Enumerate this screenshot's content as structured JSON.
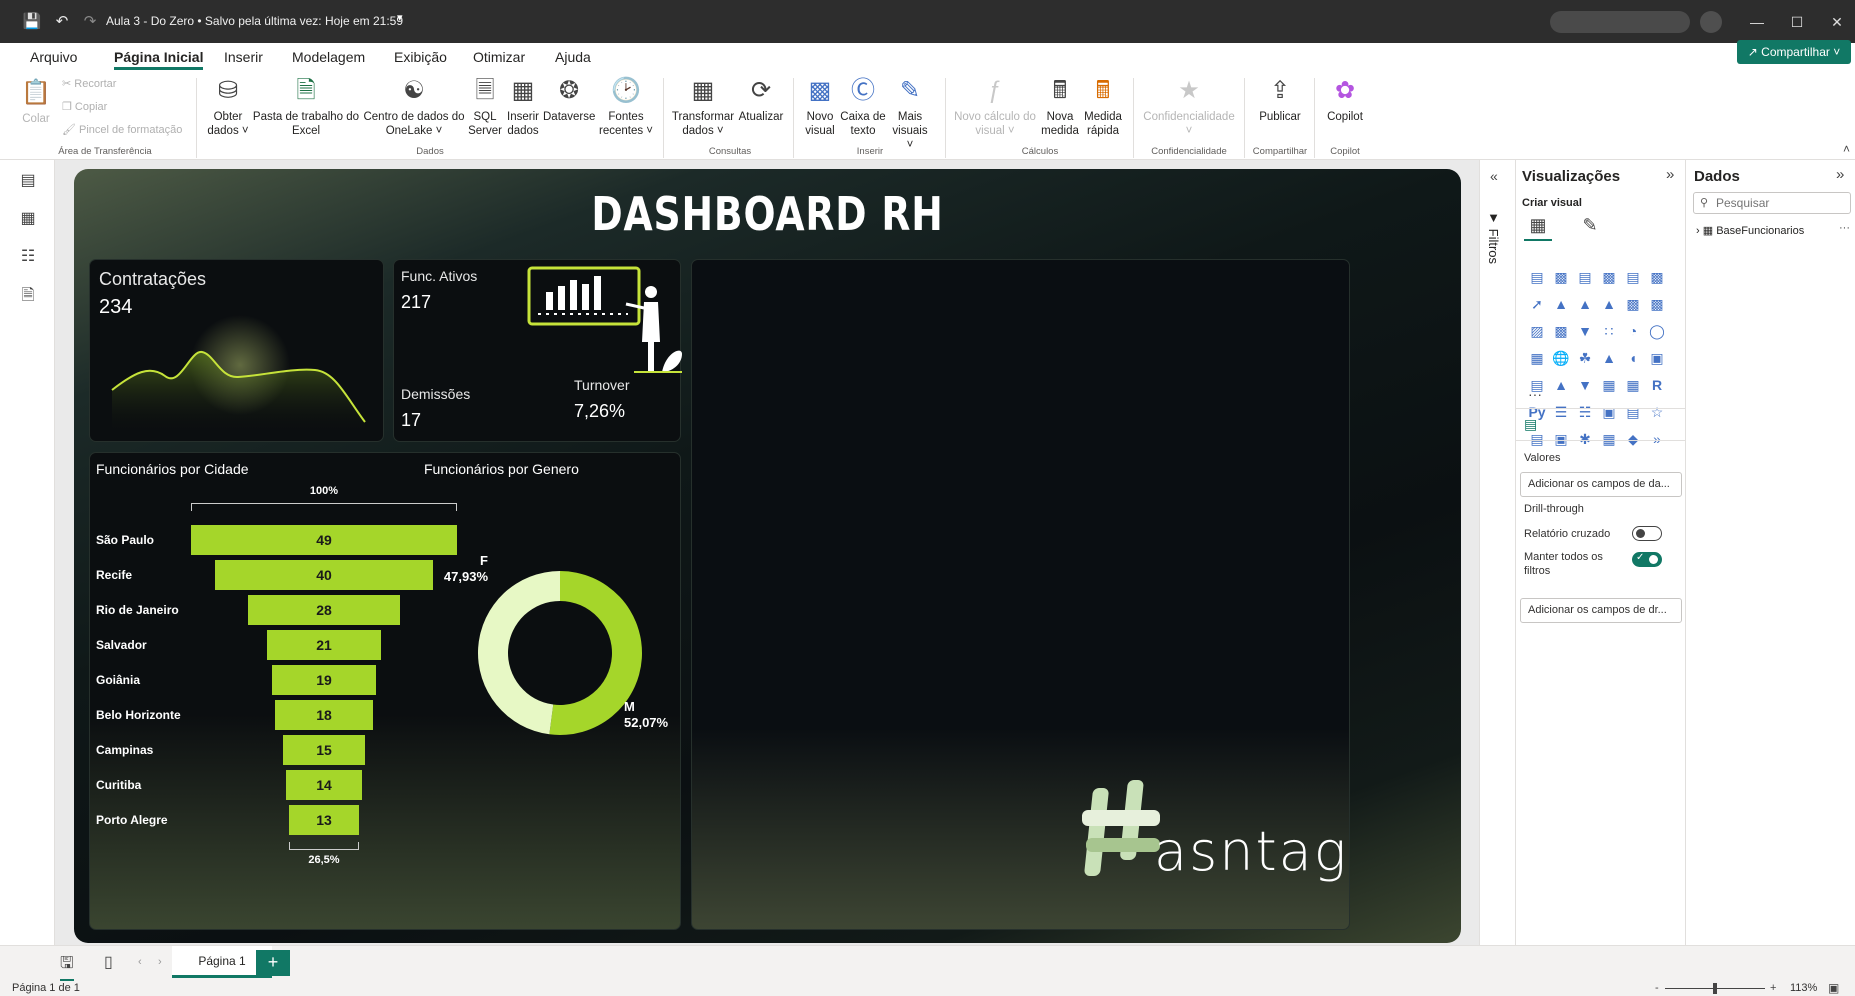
{
  "titlebar": {
    "title": "Aula 3 - Do Zero • Salvo pela última vez: Hoje em 21:59",
    "dropdown_glyph": "▾",
    "icons": [
      "save-icon",
      "undo-icon",
      "redo-icon"
    ],
    "window_controls": [
      "minimize",
      "maximize",
      "close"
    ]
  },
  "menu": {
    "items": [
      "Arquivo",
      "Página Inicial",
      "Inserir",
      "Modelagem",
      "Exibição",
      "Otimizar",
      "Ajuda"
    ],
    "active": "Página Inicial",
    "share_label": "Compartilhar"
  },
  "ribbon": {
    "clipboard": {
      "paste": "Colar",
      "cut": "Recortar",
      "copy": "Copiar",
      "format_painter": "Pincel de formatação",
      "group": "Área de Transferência"
    },
    "data": {
      "get_data": "Obter dados",
      "excel": "Pasta de trabalho do Excel",
      "onelake": "Centro de dados do OneLake",
      "sql": "SQL Server",
      "enter_data": "Inserir dados",
      "dataverse": "Dataverse",
      "recent": "Fontes recentes",
      "group": "Dados"
    },
    "queries": {
      "transform": "Transformar dados",
      "refresh": "Atualizar",
      "group": "Consultas"
    },
    "insert": {
      "new_visual": "Novo visual",
      "text_box": "Caixa de texto",
      "more_visuals": "Mais visuais",
      "group": "Inserir"
    },
    "calculations": {
      "new_calc": "Novo cálculo do visual",
      "new_measure": "Nova medida",
      "quick_measure": "Medida rápida",
      "group": "Cálculos"
    },
    "sensitivity": {
      "label": "Confidencialidade",
      "group": "Confidencialidade"
    },
    "share": {
      "publish": "Publicar",
      "group": "Compartilhar"
    },
    "copilot": {
      "label": "Copilot",
      "group": "Copilot"
    }
  },
  "report": {
    "title": "DASHBOARD RH",
    "kpis": {
      "contratacoes_label": "Contratações",
      "contratacoes_value": "234",
      "func_ativos_label": "Func. Ativos",
      "func_ativos_value": "217",
      "demissoes_label": "Demissões",
      "demissoes_value": "17",
      "turnover_label": "Turnover",
      "turnover_value": "7,26%"
    },
    "city_chart_title": "Funcionários por Cidade",
    "gender_chart_title": "Funcionários por Genero",
    "logo_text": "asntag"
  },
  "chart_data": [
    {
      "type": "bar",
      "title": "Funcionários por Cidade",
      "categories": [
        "São Paulo",
        "Recife",
        "Rio de Janeiro",
        "Salvador",
        "Goiânia",
        "Belo Horizonte",
        "Campinas",
        "Curitiba",
        "Porto Alegre"
      ],
      "values": [
        49,
        40,
        28,
        21,
        19,
        18,
        15,
        14,
        13
      ],
      "top_annotation": "100%",
      "bottom_annotation": "26,5%",
      "color": "#a5d62a"
    },
    {
      "type": "pie",
      "title": "Funcionários por Genero",
      "categories": [
        "F",
        "M"
      ],
      "values": [
        47.93,
        52.07
      ],
      "labels": [
        "47,93%",
        "52,07%"
      ],
      "colors": [
        "#e7f8c5",
        "#a5d62a"
      ],
      "donut": true
    }
  ],
  "page_tabs": {
    "tab": "Página 1",
    "add": "+"
  },
  "status": {
    "page": "Página 1 de 1",
    "zoom": "113%"
  },
  "filters_label": "Filtros",
  "viz_panel": {
    "title": "Visualizações",
    "build_visual": "Criar visual",
    "values_label": "Valores",
    "values_placeholder": "Adicionar os campos de da...",
    "drill_label": "Drill-through",
    "cross_report": "Relatório cruzado",
    "keep_filters": "Manter todos os filtros",
    "drill_placeholder": "Adicionar os campos de dr...",
    "more": "···",
    "cross_report_on": false,
    "keep_filters_on": true
  },
  "data_panel": {
    "title": "Dados",
    "search_placeholder": "Pesquisar",
    "table_name": "BaseFuncionarios",
    "more": "···"
  }
}
